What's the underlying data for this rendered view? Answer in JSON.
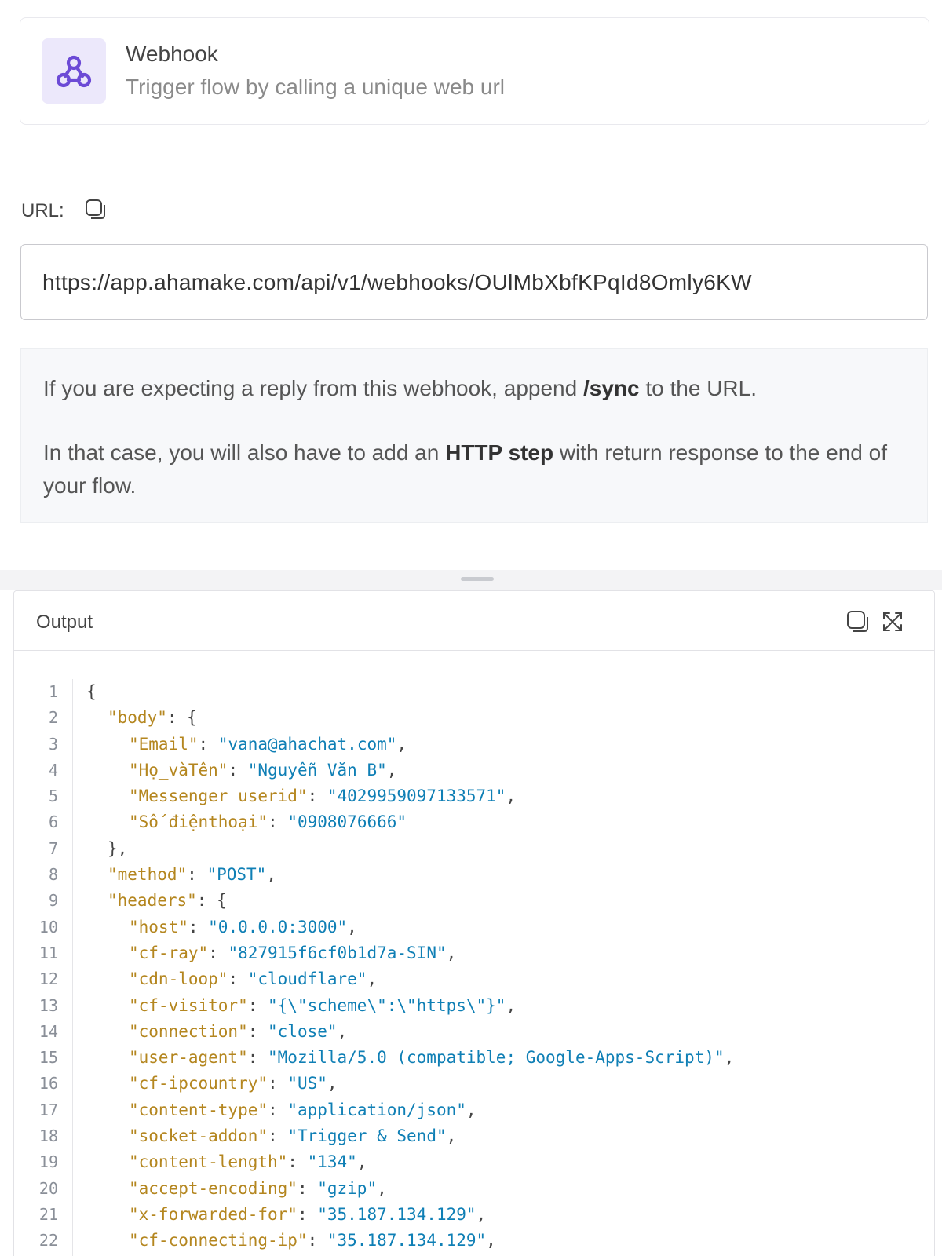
{
  "trigger": {
    "title": "Webhook",
    "subtitle": "Trigger flow by calling a unique web url",
    "icon": "webhook-icon",
    "accent": "#6c4ad6"
  },
  "url": {
    "label": "URL:",
    "value": "https://app.ahamake.com/api/v1/webhooks/OUlMbXbfKPqId8Omly6KW"
  },
  "info": {
    "p1_before": "If you are expecting a reply from this webhook, append ",
    "p1_bold": "/sync",
    "p1_after": " to the URL.",
    "p2_before": "In that case, you will also have to add an ",
    "p2_bold": "HTTP step",
    "p2_after": " with return response to the end of your flow."
  },
  "output": {
    "title": "Output",
    "lines": [
      {
        "n": "1",
        "indent": 0,
        "open": "{"
      },
      {
        "n": "2",
        "indent": 1,
        "key": "\"body\"",
        "tail": ": {"
      },
      {
        "n": "3",
        "indent": 2,
        "key": "\"Email\"",
        "val": "\"vana@ahachat.com\"",
        "end": ","
      },
      {
        "n": "4",
        "indent": 2,
        "key": "\"Họ_vàTên\"",
        "val": "\"Nguyễn Văn B\"",
        "end": ","
      },
      {
        "n": "5",
        "indent": 2,
        "key": "\"Messenger_userid\"",
        "val": "\"4029959097133571\"",
        "end": ","
      },
      {
        "n": "6",
        "indent": 2,
        "key": "\"Số_điệnthoại\"",
        "val": "\"0908076666\"",
        "end": ""
      },
      {
        "n": "7",
        "indent": 1,
        "open": "},"
      },
      {
        "n": "8",
        "indent": 1,
        "key": "\"method\"",
        "val": "\"POST\"",
        "end": ","
      },
      {
        "n": "9",
        "indent": 1,
        "key": "\"headers\"",
        "tail": ": {"
      },
      {
        "n": "10",
        "indent": 2,
        "key": "\"host\"",
        "val": "\"0.0.0.0:3000\"",
        "end": ","
      },
      {
        "n": "11",
        "indent": 2,
        "key": "\"cf-ray\"",
        "val": "\"827915f6cf0b1d7a-SIN\"",
        "end": ","
      },
      {
        "n": "12",
        "indent": 2,
        "key": "\"cdn-loop\"",
        "val": "\"cloudflare\"",
        "end": ","
      },
      {
        "n": "13",
        "indent": 2,
        "key": "\"cf-visitor\"",
        "val": "\"{\\\"scheme\\\":\\\"https\\\"}\"",
        "end": ","
      },
      {
        "n": "14",
        "indent": 2,
        "key": "\"connection\"",
        "val": "\"close\"",
        "end": ","
      },
      {
        "n": "15",
        "indent": 2,
        "key": "\"user-agent\"",
        "val": "\"Mozilla/5.0 (compatible; Google-Apps-Script)\"",
        "end": ","
      },
      {
        "n": "16",
        "indent": 2,
        "key": "\"cf-ipcountry\"",
        "val": "\"US\"",
        "end": ","
      },
      {
        "n": "17",
        "indent": 2,
        "key": "\"content-type\"",
        "val": "\"application/json\"",
        "end": ","
      },
      {
        "n": "18",
        "indent": 2,
        "key": "\"socket-addon\"",
        "val": "\"Trigger & Send\"",
        "end": ","
      },
      {
        "n": "19",
        "indent": 2,
        "key": "\"content-length\"",
        "val": "\"134\"",
        "end": ","
      },
      {
        "n": "20",
        "indent": 2,
        "key": "\"accept-encoding\"",
        "val": "\"gzip\"",
        "end": ","
      },
      {
        "n": "21",
        "indent": 2,
        "key": "\"x-forwarded-for\"",
        "val": "\"35.187.134.129\"",
        "end": ","
      },
      {
        "n": "22",
        "indent": 2,
        "key": "\"cf-connecting-ip\"",
        "val": "\"35.187.134.129\"",
        "end": ","
      }
    ]
  },
  "colors": {
    "json_key": "#b4861f",
    "json_string": "#0f7fb5",
    "icon_bg": "#ece8fb"
  }
}
